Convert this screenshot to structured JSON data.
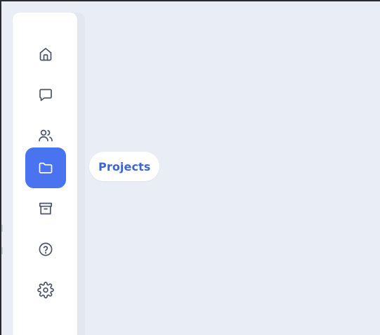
{
  "sidebar": {
    "items": [
      {
        "id": "home",
        "icon": "home-icon",
        "active": false
      },
      {
        "id": "messages",
        "icon": "message-icon",
        "active": false
      },
      {
        "id": "users",
        "icon": "users-icon",
        "active": false
      },
      {
        "id": "projects",
        "icon": "folder-icon",
        "active": true
      },
      {
        "id": "archive",
        "icon": "archive-icon",
        "active": false
      },
      {
        "id": "help",
        "icon": "help-circle-icon",
        "active": false
      },
      {
        "id": "settings",
        "icon": "gear-icon",
        "active": false
      }
    ]
  },
  "tooltip": {
    "label": "Projects"
  },
  "colors": {
    "background": "#e9edf6",
    "sidebar": "#ffffff",
    "accent": "#4a73f0",
    "icon": "#4b5566",
    "tooltip_text": "#3f66d6"
  }
}
